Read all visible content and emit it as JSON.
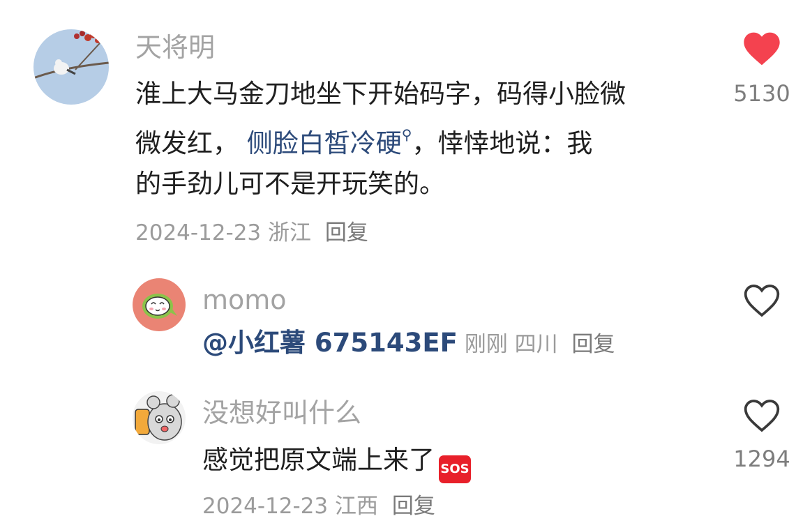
{
  "comments": [
    {
      "username": "天将明",
      "lines": [
        "淮上大马金刀地坐下开始码字，码得小脸微",
        {
          "before": "微发红， ",
          "link": "侧脸白皙冷硬",
          "after": "，悻悻地说：我"
        },
        "的手劲儿可不是开玩笑的。"
      ],
      "date": "2024-12-23",
      "location": "浙江",
      "reply_label": "回复",
      "like_count": "5130",
      "liked": true
    },
    {
      "username": "momo",
      "mention": "@小红薯 675143EF",
      "date": "刚刚",
      "location": "四川",
      "reply_label": "回复",
      "like_count": "",
      "liked": false
    },
    {
      "username": "没想好叫什么",
      "text": "感觉把原文端上来了",
      "emoji_text": "SOS",
      "date": "2024-12-23",
      "location": "江西",
      "reply_label": "回复",
      "like_count": "1294",
      "liked": false
    }
  ],
  "colors": {
    "liked_heart": "#f4424f",
    "link": "#2c4a7a",
    "username": "#a3a3a3"
  },
  "icons": [
    "heart-filled-icon",
    "heart-outline-icon",
    "search-link-icon",
    "sos-emoji"
  ]
}
